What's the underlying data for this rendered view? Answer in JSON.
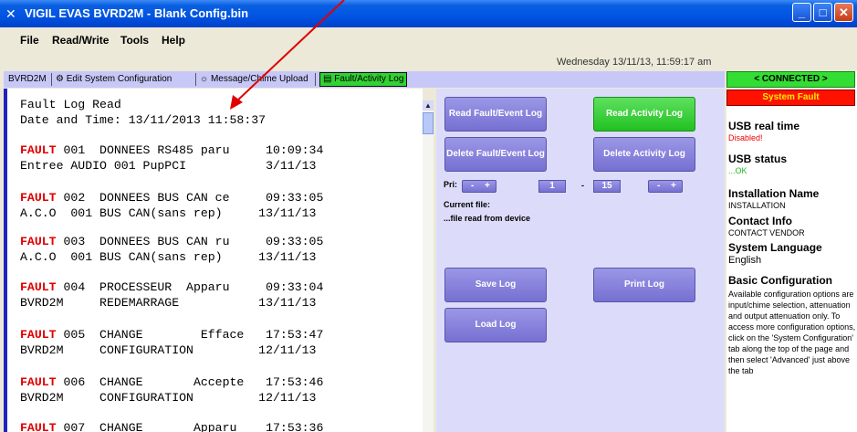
{
  "window": {
    "title": "VIGIL EVAS BVRD2M - Blank Config.bin",
    "buttons": [
      "_",
      "□",
      "✕"
    ]
  },
  "menu": [
    "File",
    "Read/Write",
    "Tools",
    "Help"
  ],
  "datetime": "Wednesday 13/11/13, 11:59:17 am",
  "tabs": {
    "device": "BVRD2M",
    "edit_system": "Edit System Configuration",
    "message_chime": "Message/Chime Upload",
    "fault_log": "Fault/Activity Log"
  },
  "log": {
    "header": [
      "Fault Log Read",
      "Date and Time: 13/11/2013 11:58:37"
    ],
    "entries": [
      {
        "word": "FAULT",
        "line1": " 001  DONNEES RS485 paru     10:09:34",
        "line2": "Entree AUDIO 001 PupPCI           3/11/13"
      },
      {
        "word": "FAULT",
        "line1": " 002  DONNEES BUS CAN ce     09:33:05",
        "line2": "A.C.O  001 BUS CAN(sans rep)     13/11/13"
      },
      {
        "word": "FAULT",
        "line1": " 003  DONNEES BUS CAN ru     09:33:05",
        "line2": "A.C.O  001 BUS CAN(sans rep)     13/11/13"
      },
      {
        "word": "FAULT",
        "line1": " 004  PROCESSEUR  Apparu     09:33:04",
        "line2": "BVRD2M     REDEMARRAGE           13/11/13"
      },
      {
        "word": "FAULT",
        "line1": " 005  CHANGE        Efface   17:53:47",
        "line2": "BVRD2M     CONFIGURATION         12/11/13"
      },
      {
        "word": "FAULT",
        "line1": " 006  CHANGE       Accepte   17:53:46",
        "line2": "BVRD2M     CONFIGURATION         12/11/13"
      },
      {
        "word": "FAULT",
        "line1": " 007  CHANGE       Apparu    17:53:36",
        "line2": ""
      }
    ]
  },
  "controls": {
    "read_fault": "Read Fault/Event Log",
    "read_activity": "Read Activity Log",
    "delete_fault": "Delete Fault/Event Log",
    "delete_activity": "Delete Activity Log",
    "pri_label": "Pri:",
    "minus": "-",
    "plus": "+",
    "pri_from": "1",
    "dash": "-",
    "pri_to": "15",
    "current_file_label": "Current file:",
    "current_file_value": "...file read from device",
    "save": "Save Log",
    "print": "Print Log",
    "load": "Load Log"
  },
  "status": {
    "connected": "< CONNECTED >",
    "system_fault": "System Fault",
    "usb_rt_label": "USB real time",
    "usb_rt_value": "Disabled!",
    "usb_status_label": "USB status",
    "usb_status_value": "...OK",
    "install_label": "Installation Name",
    "install_value": "INSTALLATION",
    "contact_label": "Contact Info",
    "contact_value": "CONTACT VENDOR",
    "lang_label": "System Language",
    "lang_value": "English",
    "basic_label": "Basic Configuration",
    "basic_desc": "Available configuration options are input/chime selection, attenuation and output attenuation only. To access more configuration options, click on the 'System Configuration' tab along the top of the page and then select 'Advanced' just above the tab"
  },
  "colors": {
    "titlebar": "#0054e3",
    "fault": "#e00000",
    "connected": "#33dd33",
    "system_fault": "#ff1100",
    "button": "#7670d2"
  }
}
